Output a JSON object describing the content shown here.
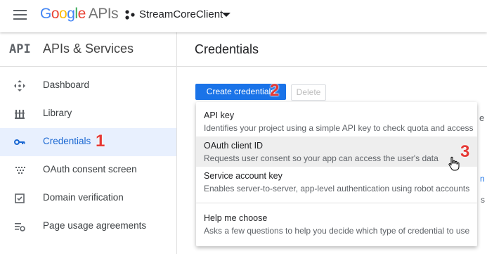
{
  "header": {
    "logo_google": "Google",
    "logo_apis": "APIs",
    "project_name": "StreamCoreClient"
  },
  "sidebar": {
    "api_mark": "API",
    "title": "APIs & Services",
    "items": [
      {
        "label": "Dashboard",
        "icon": "dashboard-icon"
      },
      {
        "label": "Library",
        "icon": "library-icon"
      },
      {
        "label": "Credentials",
        "icon": "key-icon",
        "active": true
      },
      {
        "label": "OAuth consent screen",
        "icon": "consent-icon"
      },
      {
        "label": "Domain verification",
        "icon": "checkbox-icon"
      },
      {
        "label": "Page usage agreements",
        "icon": "settings-list-icon"
      }
    ]
  },
  "main": {
    "title": "Credentials",
    "create_button": "Create credentials",
    "delete_button": "Delete",
    "peek_1": "e",
    "peek_2": "n",
    "peek_3": "s"
  },
  "dropdown": {
    "items": [
      {
        "title": "API key",
        "desc": "Identifies your project using a simple API key to check quota and access"
      },
      {
        "title": "OAuth client ID",
        "desc": "Requests user consent so your app can access the user's data"
      },
      {
        "title": "Service account key",
        "desc": "Enables server-to-server, app-level authentication using robot accounts"
      },
      {
        "title": "Help me choose",
        "desc": "Asks a few questions to help you decide which type of credential to use"
      }
    ]
  },
  "annotations": {
    "step1": "1",
    "step2": "2",
    "step3": "3"
  },
  "colors": {
    "accent": "#1a73e8",
    "active_bg": "#e8f0fe",
    "annotation": "#e53935"
  }
}
